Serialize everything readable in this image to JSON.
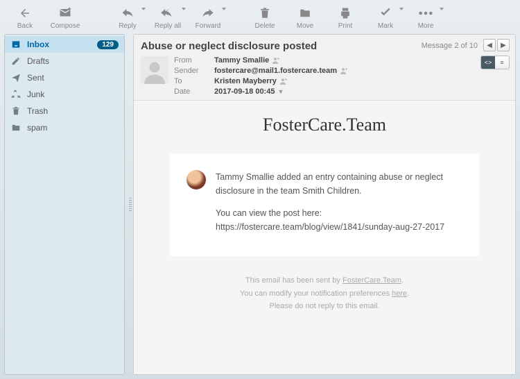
{
  "toolbar": {
    "back": "Back",
    "compose": "Compose",
    "reply": "Reply",
    "reply_all": "Reply all",
    "forward": "Forward",
    "delete": "Delete",
    "move": "Move",
    "print": "Print",
    "mark": "Mark",
    "more": "More"
  },
  "folders": [
    {
      "name": "Inbox",
      "count": "129",
      "selected": true,
      "icon": "inbox"
    },
    {
      "name": "Drafts",
      "icon": "pencil"
    },
    {
      "name": "Sent",
      "icon": "send"
    },
    {
      "name": "Junk",
      "icon": "recycle"
    },
    {
      "name": "Trash",
      "icon": "trash"
    },
    {
      "name": "spam",
      "icon": "folder"
    }
  ],
  "message": {
    "subject": "Abuse or neglect disclosure posted",
    "counter": "Message 2 of 10",
    "meta": {
      "from_label": "From",
      "from_value": "Tammy Smallie",
      "sender_label": "Sender",
      "sender_value": "fostercare@mail1.fostercare.team",
      "to_label": "To",
      "to_value": "Kristen Mayberry",
      "date_label": "Date",
      "date_value": "2017-09-18 00:45"
    },
    "body": {
      "brand": "FosterCare.Team",
      "line1": "Tammy Smallie added an entry containing abuse or neglect disclosure in the team Smith Children.",
      "line2": "You can view the post here:",
      "link": "https://fostercare.team/blog/view/1841/sunday-aug-27-2017",
      "footer1_a": "This email has been sent by ",
      "footer1_b": "FosterCare.Team",
      "footer1_c": ".",
      "footer2_a": "You can modify your notification preferences ",
      "footer2_b": "here",
      "footer2_c": ".",
      "footer3": "Please do not reply to this email."
    }
  }
}
